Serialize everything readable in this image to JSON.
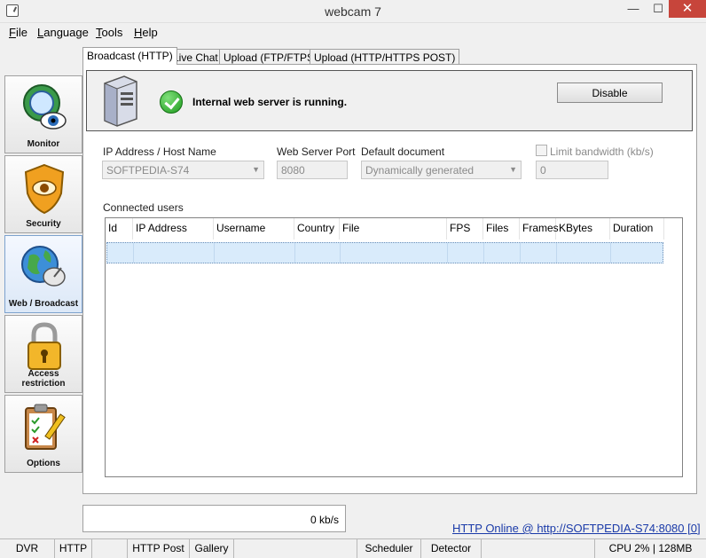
{
  "window": {
    "title": "webcam 7",
    "minimize": "—",
    "maximize": "☐",
    "close": "✕"
  },
  "menu": [
    {
      "label": "File",
      "accel": "F",
      "rest": "ile"
    },
    {
      "label": "Language",
      "accel": "L",
      "rest": "anguage"
    },
    {
      "label": "Tools",
      "accel": "T",
      "rest": "ools"
    },
    {
      "label": "Help",
      "accel": "H",
      "rest": "elp"
    }
  ],
  "sidebar": {
    "items": [
      {
        "label": "Monitor",
        "icon": "monitor-eye-icon"
      },
      {
        "label": "Security",
        "icon": "shield-eye-icon"
      },
      {
        "label": "Web / Broadcast",
        "icon": "globe-dish-icon",
        "active": true
      },
      {
        "label": "Access restriction",
        "icon": "padlock-icon"
      },
      {
        "label": "Options",
        "icon": "clipboard-pencil-icon"
      }
    ]
  },
  "tabs": [
    {
      "label": "Broadcast (HTTP)",
      "active": true
    },
    {
      "label": "Live Chat"
    },
    {
      "label": "Upload (FTP/FTPS)"
    },
    {
      "label": "Upload (HTTP/HTTPS POST)"
    }
  ],
  "server": {
    "status_text": "Internal web server is running.",
    "disable_label": "Disable"
  },
  "fields": {
    "ip_label": "IP Address / Host Name",
    "ip_value": "SOFTPEDIA-S74",
    "port_label": "Web Server Port",
    "port_value": "8080",
    "doc_label": "Default document",
    "doc_value": "Dynamically generated",
    "limit_label": "Limit bandwidth (kb/s)",
    "limit_value": "0"
  },
  "connected_users": {
    "label": "Connected users",
    "columns": [
      "Id",
      "IP Address",
      "Username",
      "Country",
      "File",
      "FPS",
      "Files",
      "Frames",
      "KBytes",
      "Duration"
    ]
  },
  "transfer_rate": "0 kb/s",
  "online_link": "HTTP Online @ http://SOFTPEDIA-S74:8080 [0]",
  "statusbar": {
    "dvr": "DVR",
    "http": "HTTP",
    "http_post": "HTTP Post",
    "gallery": "Gallery",
    "scheduler": "Scheduler",
    "detector": "Detector",
    "cpu": "CPU 2% | 128MB"
  },
  "colors": {
    "selected_row": "#d9ebfb",
    "link": "#1a3aa8",
    "close_button": "#c7453b",
    "running_check": "#1e9a1e"
  }
}
